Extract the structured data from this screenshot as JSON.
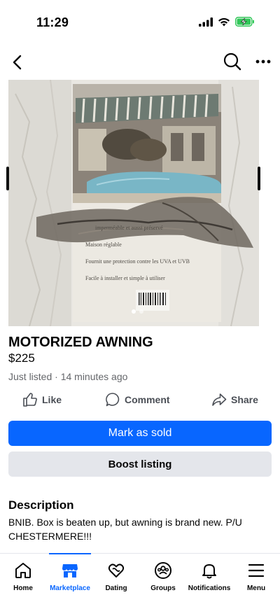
{
  "status_bar": {
    "time": "11:29"
  },
  "nav": {
    "back_icon": "chevron-left-icon",
    "search_icon": "search-icon",
    "more_icon": "more-horizontal-icon"
  },
  "photo": {
    "box_text_lines": [
      "imperméable et aussi préservé",
      "Maison réglable",
      "Fournit une protection contre les UVA et UVB",
      "Facile à installer et simple à utiliser"
    ],
    "carousel_count": 2,
    "carousel_active": 1
  },
  "listing": {
    "title": "MOTORIZED AWNING",
    "price": "$225",
    "meta": "Just listed · 14 minutes ago"
  },
  "actions": {
    "like": "Like",
    "comment": "Comment",
    "share": "Share"
  },
  "buttons": {
    "mark_sold": "Mark as sold",
    "boost": "Boost listing"
  },
  "description": {
    "heading": "Description",
    "text": "BNIB. Box is beaten up, but awning is brand new. P/U CHESTERMERE!!!"
  },
  "tabs": [
    {
      "label": "Home",
      "icon": "home-icon",
      "active": false
    },
    {
      "label": "Marketplace",
      "icon": "marketplace-icon",
      "active": true
    },
    {
      "label": "Dating",
      "icon": "heart-icon",
      "active": false
    },
    {
      "label": "Groups",
      "icon": "groups-icon",
      "active": false
    },
    {
      "label": "Notifications",
      "icon": "bell-icon",
      "active": false
    },
    {
      "label": "Menu",
      "icon": "menu-icon",
      "active": false
    }
  ],
  "colors": {
    "accent": "#0866ff",
    "secondary_button": "#e4e6eb",
    "muted_text": "#65676b"
  }
}
